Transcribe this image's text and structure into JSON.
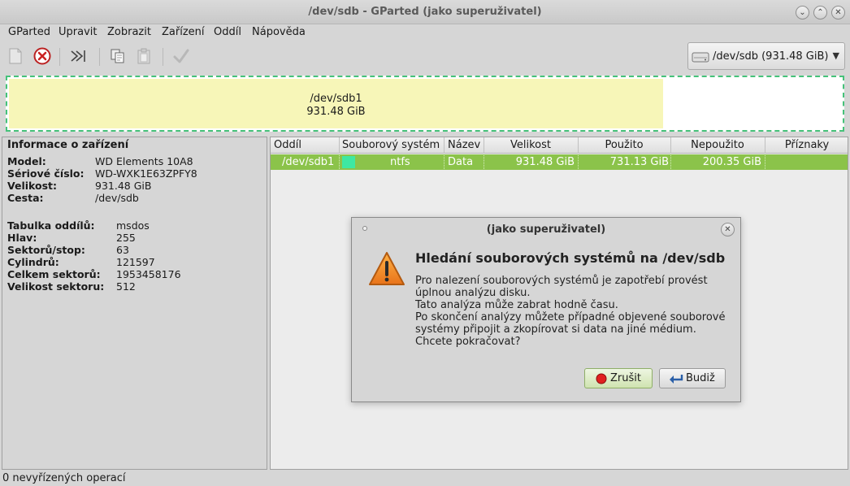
{
  "window": {
    "title": "/dev/sdb - GParted (jako superuživatel)"
  },
  "menu": [
    "GParted",
    "Upravit",
    "Zobrazit",
    "Zařízení",
    "Oddíl",
    "Nápověda"
  ],
  "device_selector": {
    "label": "/dev/sdb   (931.48 GiB)"
  },
  "disk_map": {
    "partition_name": "/dev/sdb1",
    "partition_size": "931.48 GiB",
    "used_fraction": 0.785
  },
  "device_info": {
    "heading": "Informace o zařízení",
    "rows": [
      {
        "key": "Model:",
        "value": "WD Elements 10A8"
      },
      {
        "key": "Sériové číslo:",
        "value": "WD-WXK1E63ZPFY8"
      },
      {
        "key": "Velikost:",
        "value": "931.48 GiB"
      },
      {
        "key": "Cesta:",
        "value": "/dev/sdb"
      }
    ],
    "rows2": [
      {
        "key": "Tabulka oddílů:",
        "value": "msdos"
      },
      {
        "key": "Hlav:",
        "value": "255"
      },
      {
        "key": "Sektorů/stop:",
        "value": "63"
      },
      {
        "key": "Cylindrů:",
        "value": "121597"
      },
      {
        "key": "Celkem sektorů:",
        "value": "1953458176"
      },
      {
        "key": "Velikost sektoru:",
        "value": "512"
      }
    ]
  },
  "table": {
    "headers": [
      "Oddíl",
      "Souborový systém",
      "Název",
      "Velikost",
      "Použito",
      "Nepoužito",
      "Příznaky"
    ],
    "row": {
      "partition": "/dev/sdb1",
      "filesystem": "ntfs",
      "label": "Data",
      "size": "931.48 GiB",
      "used": "731.13 GiB",
      "unused": "200.35 GiB",
      "flags": ""
    },
    "fs_color": "#3ee8a2"
  },
  "status": "0 nevyřízených operací",
  "dialog": {
    "title": "(jako superuživatel)",
    "heading": "Hledání souborových systémů na /dev/sdb",
    "lines": [
      "Pro nalezení souborových systémů je zapotřebí provést",
      "úplnou analýzu disku.",
      "Tato analýza může zabrat hodně času.",
      "Po skončení analýzy můžete případné objevené souborové",
      "systémy připojit a zkopírovat si data na jiné médium.",
      "Chcete pokračovat?"
    ],
    "cancel_label": "Zrušit",
    "ok_label": "Budiž"
  },
  "colors": {
    "partition_fill": "#f7f6b8",
    "selection": "#8bc34a",
    "map_border": "#46c27a"
  }
}
